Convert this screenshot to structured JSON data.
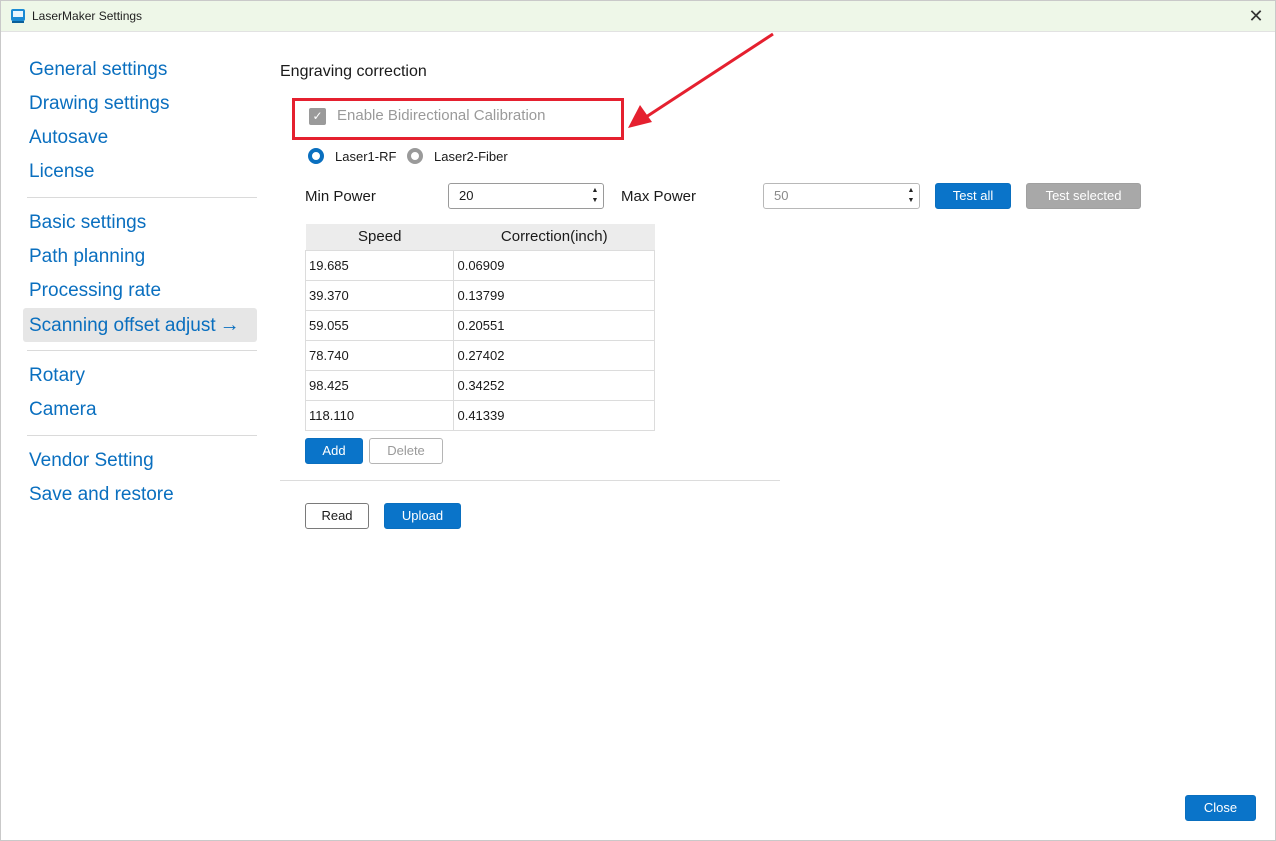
{
  "window": {
    "title": "LaserMaker Settings"
  },
  "sidebar": {
    "groups": [
      [
        "General settings",
        "Drawing settings",
        "Autosave",
        "License"
      ],
      [
        "Basic settings",
        "Path planning",
        "Processing rate",
        "Scanning offset adjust"
      ],
      [
        "Rotary",
        "Camera"
      ],
      [
        "Vendor Setting",
        "Save and restore"
      ]
    ],
    "active": "Scanning offset adjust"
  },
  "main": {
    "section_title": "Engraving correction",
    "bidirectional": {
      "label": "Enable Bidirectional Calibration",
      "checked": true,
      "enabled": false
    },
    "lasers": [
      {
        "label": "Laser1-RF",
        "selected": true
      },
      {
        "label": "Laser2-Fiber",
        "selected": false
      }
    ],
    "min_power": {
      "label": "Min Power",
      "value": "20"
    },
    "max_power": {
      "label": "Max Power",
      "value": "50"
    },
    "test_all_label": "Test all",
    "test_selected_label": "Test selected",
    "table": {
      "headers": [
        "Speed",
        "Correction(inch)"
      ],
      "rows": [
        [
          "19.685",
          "0.06909"
        ],
        [
          "39.370",
          "0.13799"
        ],
        [
          "59.055",
          "0.20551"
        ],
        [
          "78.740",
          "0.27402"
        ],
        [
          "98.425",
          "0.34252"
        ],
        [
          "118.110",
          "0.41339"
        ]
      ]
    },
    "add_label": "Add",
    "delete_label": "Delete",
    "read_label": "Read",
    "upload_label": "Upload"
  },
  "footer": {
    "close_label": "Close"
  },
  "colors": {
    "accent": "#0a74c9",
    "highlight_box": "#e5202f",
    "titlebar": "#eef7e8"
  },
  "icons": {
    "app": "lasermaker-app-icon",
    "close": "close-icon",
    "active_arrow": "arrow-right-icon"
  }
}
